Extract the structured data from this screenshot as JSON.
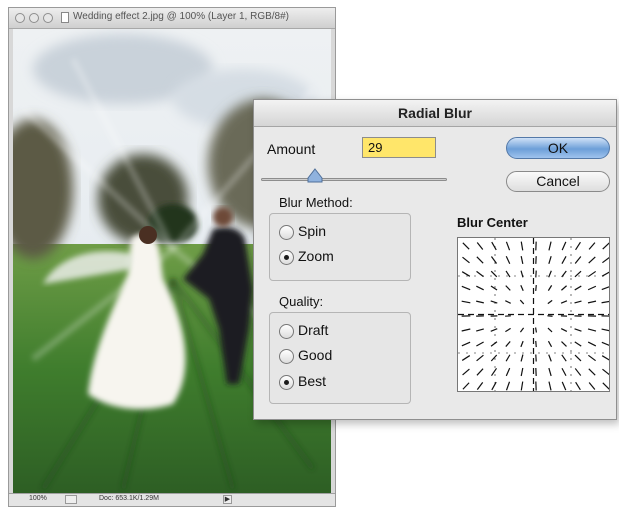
{
  "document_window": {
    "title": "Wedding effect 2.jpg @ 100% (Layer 1, RGB/8#)",
    "status": {
      "zoom": "100%",
      "doc_info": "Doc: 653.1K/1.29M"
    }
  },
  "radial_blur": {
    "title": "Radial Blur",
    "amount_label": "Amount",
    "amount_value": "29",
    "amount_fraction": 0.29,
    "ok_label": "OK",
    "cancel_label": "Cancel",
    "blur_method_label": "Blur Method:",
    "blur_method_options": [
      "Spin",
      "Zoom"
    ],
    "blur_method_selected": "Zoom",
    "quality_label": "Quality:",
    "quality_options": [
      "Draft",
      "Good",
      "Best"
    ],
    "quality_selected": "Best",
    "blur_center_label": "Blur Center"
  },
  "colors": {
    "amount_field_bg": "#ffe66a",
    "ok_button": "#6d9fd8"
  }
}
